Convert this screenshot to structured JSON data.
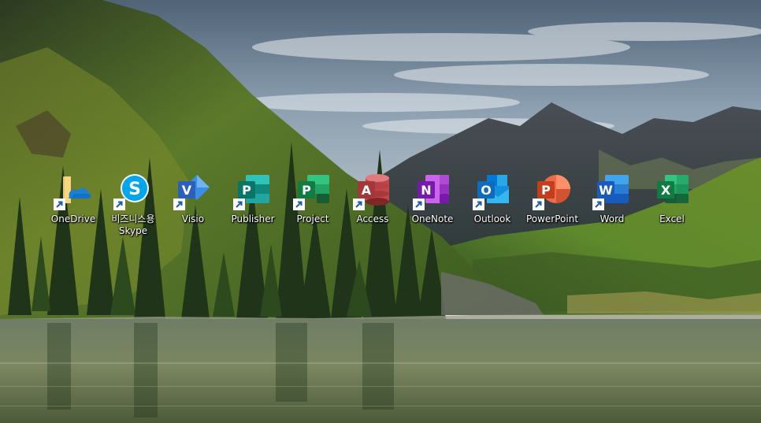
{
  "desktop": {
    "wallpaper": {
      "subject": "mountain-lake-landscape",
      "sky_color": "#7c90a4",
      "water_color": "#5a6a48",
      "forest_color": "#2f4a24"
    },
    "icons": [
      {
        "label": "OneDrive",
        "label2": "",
        "icon": "onedrive-icon",
        "color": "#0f6cbd",
        "shortcut": true
      },
      {
        "label": "비즈니스용",
        "label2": "Skype",
        "icon": "skype-icon",
        "color": "#00a6ed",
        "shortcut": true
      },
      {
        "label": "Visio",
        "label2": "",
        "icon": "visio-icon",
        "color": "#2b5fbc",
        "shortcut": true
      },
      {
        "label": "Publisher",
        "label2": "",
        "icon": "publisher-icon",
        "color": "#077568",
        "shortcut": true
      },
      {
        "label": "Project",
        "label2": "",
        "icon": "project-icon",
        "color": "#107c41",
        "shortcut": true
      },
      {
        "label": "Access",
        "label2": "",
        "icon": "access-icon",
        "color": "#a4373a",
        "shortcut": true
      },
      {
        "label": "OneNote",
        "label2": "",
        "icon": "onenote-icon",
        "color": "#7719aa",
        "shortcut": true
      },
      {
        "label": "Outlook",
        "label2": "",
        "icon": "outlook-icon",
        "color": "#0f6cbd",
        "shortcut": true
      },
      {
        "label": "PowerPoint",
        "label2": "",
        "icon": "powerpoint-icon",
        "color": "#c43e1c",
        "shortcut": true
      },
      {
        "label": "Word",
        "label2": "",
        "icon": "word-icon",
        "color": "#185abd",
        "shortcut": true
      },
      {
        "label": "Excel",
        "label2": "",
        "icon": "excel-icon",
        "color": "#107c41",
        "shortcut": true
      }
    ],
    "app_letters": {
      "visio": "V",
      "publisher": "P",
      "project": "P",
      "access": "A",
      "onenote": "N",
      "outlook": "O",
      "powerpoint": "P",
      "word": "W",
      "excel": "X"
    }
  }
}
